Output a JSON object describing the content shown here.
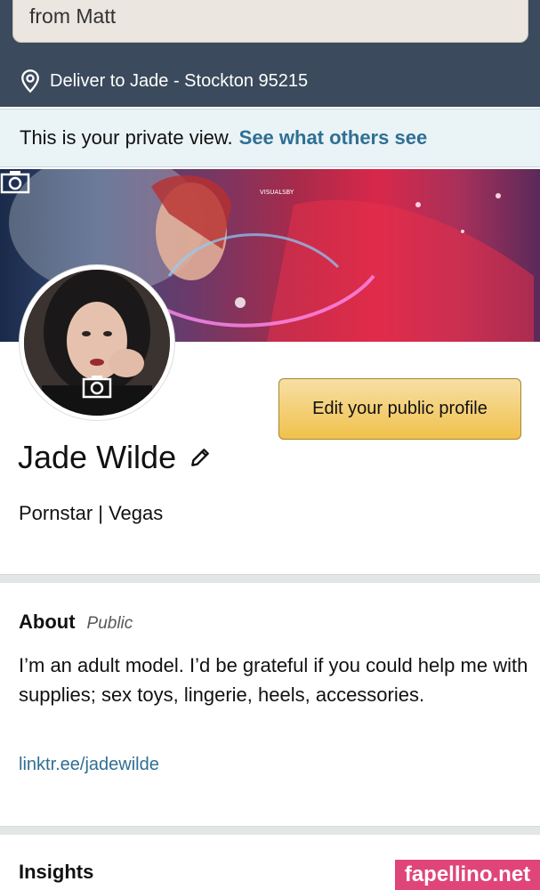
{
  "search": {
    "text": "from Matt"
  },
  "deliver": {
    "text": "Deliver to Jade - Stockton 95215"
  },
  "private_view": {
    "text": "This is your private view.",
    "link": "See what others see"
  },
  "banner": {
    "overlay_text": "VISUALSBY"
  },
  "profile": {
    "edit_button": "Edit your public profile",
    "name": "Jade Wilde",
    "tagline": "Pornstar | Vegas"
  },
  "about": {
    "title": "About",
    "visibility": "Public",
    "text": "I’m an adult model. I’d be grateful if you could help me with supplies; sex toys, lingerie, heels, accessories.",
    "link": "linktr.ee/jadewilde"
  },
  "insights": {
    "title": "Insights"
  },
  "watermark": {
    "text": "fapellino.net"
  },
  "colors": {
    "header_bg": "#3b4a5c",
    "link": "#2f6f94",
    "button": "#f0c14b",
    "watermark": "#e0457a"
  }
}
